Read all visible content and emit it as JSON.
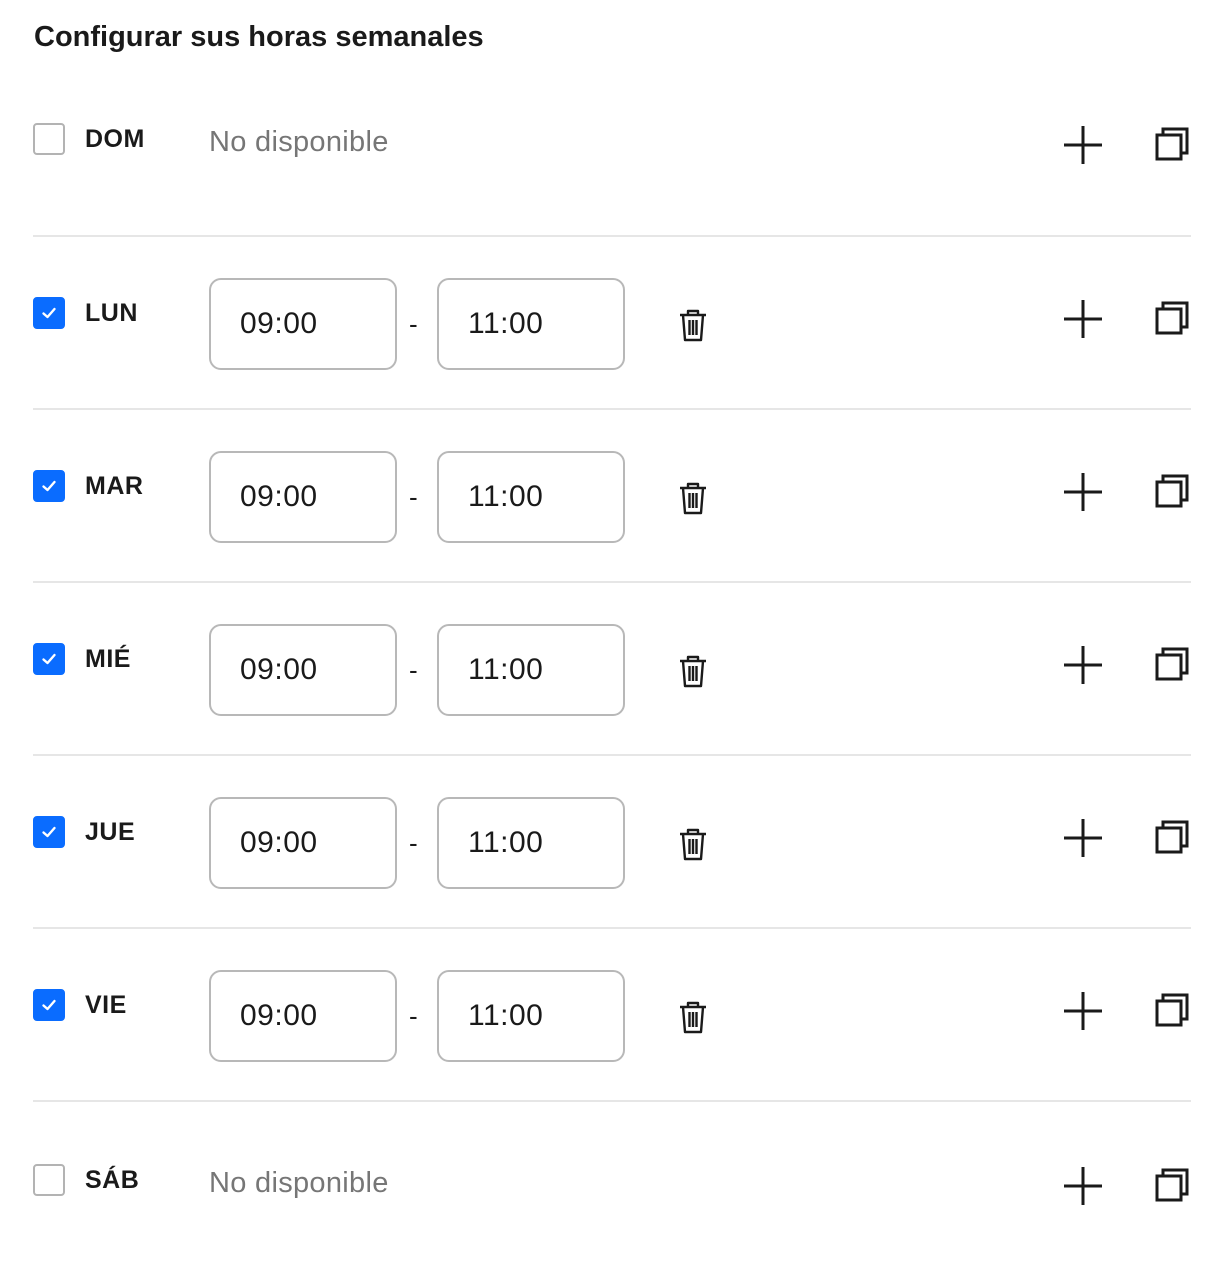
{
  "title": "Configurar sus horas semanales",
  "separator": "-",
  "days": [
    {
      "label": "DOM",
      "available": false,
      "status": "No disponible"
    },
    {
      "label": "LUN",
      "available": true,
      "start": "09:00",
      "end": "11:00"
    },
    {
      "label": "MAR",
      "available": true,
      "start": "09:00",
      "end": "11:00"
    },
    {
      "label": "MIÉ",
      "available": true,
      "start": "09:00",
      "end": "11:00"
    },
    {
      "label": "JUE",
      "available": true,
      "start": "09:00",
      "end": "11:00"
    },
    {
      "label": "VIE",
      "available": true,
      "start": "09:00",
      "end": "11:00"
    },
    {
      "label": "SÁB",
      "available": false,
      "status": "No disponible"
    }
  ],
  "colors": {
    "accent": "#0a6cff",
    "muted_text": "#767676",
    "border": "#b8b8b8",
    "divider": "#e6e6e6"
  },
  "icons": {
    "check": "check-icon",
    "delete": "trash-icon",
    "add": "plus-icon",
    "copy": "copy-icon"
  }
}
